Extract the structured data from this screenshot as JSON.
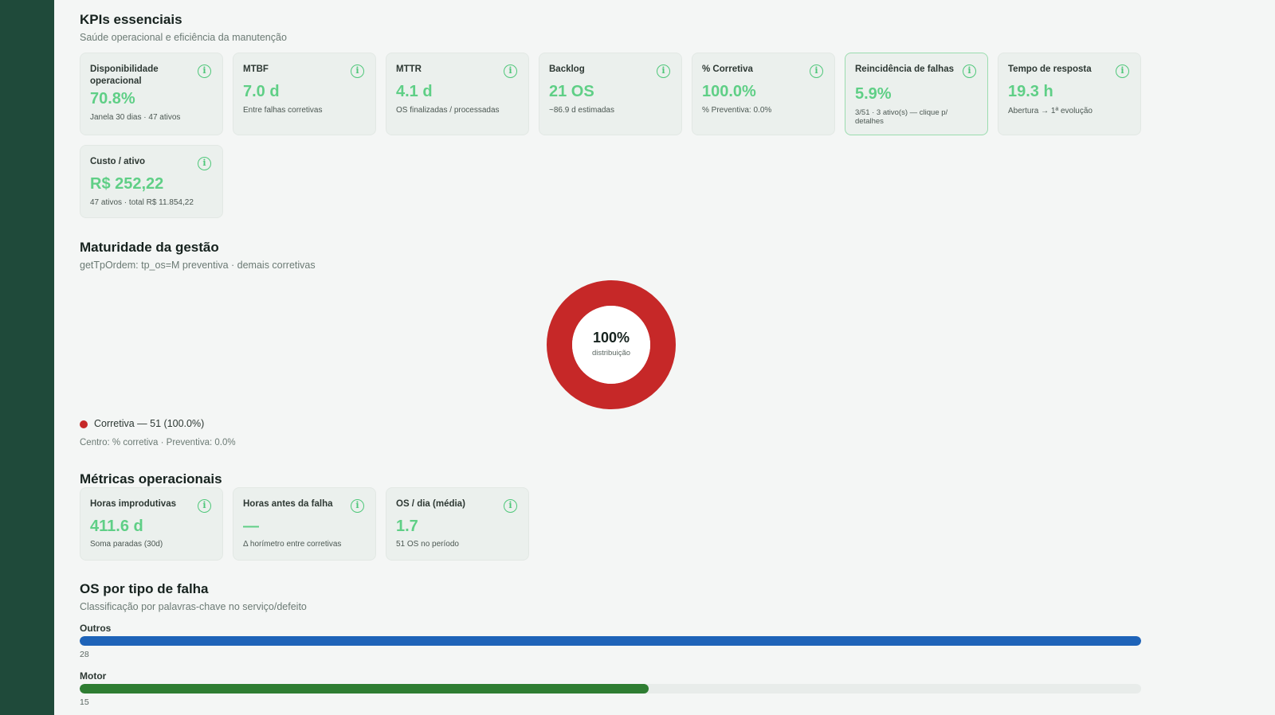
{
  "kpis": {
    "title": "KPIs essenciais",
    "subtitle": "Saúde operacional e eficiência da manutenção",
    "cards": [
      {
        "label": "Disponibilidade operacional",
        "value": "70.8%",
        "note": "Janela 30 dias · 47 ativos"
      },
      {
        "label": "MTBF",
        "value": "7.0 d",
        "note": "Entre falhas corretivas"
      },
      {
        "label": "MTTR",
        "value": "4.1 d",
        "note": "OS finalizadas / processadas"
      },
      {
        "label": "Backlog",
        "value": "21 OS",
        "note": "~86.9 d estimadas"
      },
      {
        "label": "% Corretiva",
        "value": "100.0%",
        "note": "% Preventiva: 0.0%"
      },
      {
        "label": "Reincidência de falhas",
        "value": "5.9%",
        "note": "3/51 · 3 ativo(s) — clique p/ detalhes"
      },
      {
        "label": "Tempo de resposta",
        "value": "19.3 h",
        "note": "Abertura → 1ª evolução"
      },
      {
        "label": "Custo / ativo",
        "value": "R$ 252,22",
        "note": "47 ativos · total R$ 11.854,22"
      }
    ]
  },
  "maturidade": {
    "title": "Maturidade da gestão",
    "subtitle": "getTpOrdem: tp_os=M preventiva · demais corretivas",
    "center_value": "100%",
    "center_label": "distribuição",
    "legend": "Corretiva — 51 (100.0%)",
    "note": "Centro: % corretiva · Preventiva: 0.0%",
    "corretiva_fraction": 1.0,
    "color": "#c62828"
  },
  "metricas": {
    "title": "Métricas operacionais",
    "cards": [
      {
        "label": "Horas improdutivas",
        "value": "411.6 d",
        "note": "Soma paradas (30d)"
      },
      {
        "label": "Horas antes da falha",
        "value": "—",
        "note": "Δ horímetro entre corretivas"
      },
      {
        "label": "OS / dia (média)",
        "value": "1.7",
        "note": "51 OS no período"
      }
    ]
  },
  "falhas": {
    "title": "OS por tipo de falha",
    "subtitle": "Classificação por palavras-chave no serviço/defeito",
    "bars": [
      {
        "label": "Outros",
        "count": "28",
        "fraction": 1.0,
        "color": "#1e63b8"
      },
      {
        "label": "Motor",
        "count": "15",
        "fraction": 0.536,
        "color": "#2e7d32"
      }
    ]
  },
  "icons": {
    "info": "info-icon",
    "info_glyph": "i"
  },
  "colors": {
    "sidebar": "#1f4a3a",
    "kpi_value": "#5fcf86",
    "accent_border": "#9bdcaf"
  }
}
